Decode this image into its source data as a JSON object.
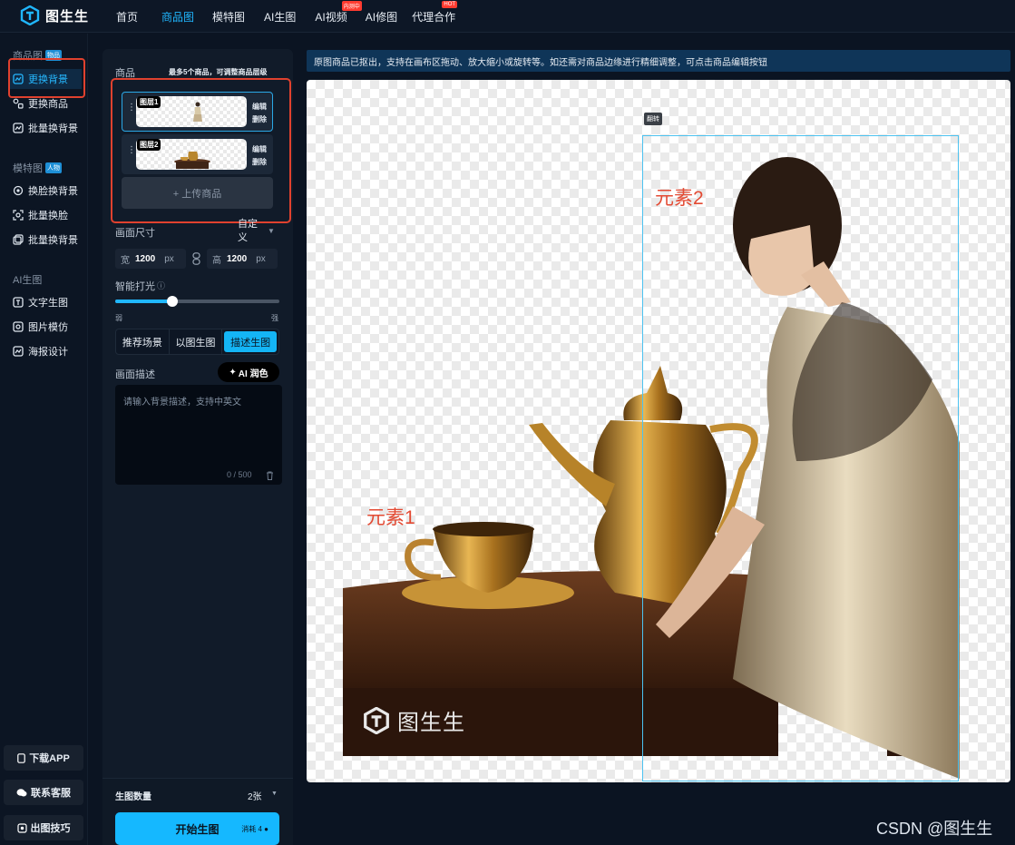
{
  "app": {
    "name": "图生生"
  },
  "nav": [
    {
      "label": "首页"
    },
    {
      "label": "商品图",
      "active": true
    },
    {
      "label": "模特图"
    },
    {
      "label": "AI生图"
    },
    {
      "label": "AI视频",
      "badge": "内测中"
    },
    {
      "label": "AI修图"
    },
    {
      "label": "代理合作",
      "badge": "HOT"
    }
  ],
  "sidebar": {
    "sections": [
      {
        "title": "商品图",
        "tag": "物品",
        "items": [
          {
            "label": "更换背景",
            "active": true
          },
          {
            "label": "更换商品"
          },
          {
            "label": "批量换背景"
          }
        ]
      },
      {
        "title": "模特图",
        "tag": "人物",
        "items": [
          {
            "label": "换脸换背景"
          },
          {
            "label": "批量换脸"
          },
          {
            "label": "批量换背景"
          }
        ]
      },
      {
        "title": "AI生图",
        "items": [
          {
            "label": "文字生图"
          },
          {
            "label": "图片模仿"
          },
          {
            "label": "海报设计"
          }
        ]
      }
    ],
    "bottom": [
      {
        "label": "下载APP"
      },
      {
        "label": "联系客服"
      },
      {
        "label": "出图技巧"
      }
    ]
  },
  "panel": {
    "products_label": "商品",
    "products_hint": "最多5个商品，可调整商品层级",
    "layers": [
      {
        "name": "图层1",
        "edit": "编辑",
        "delete": "删除"
      },
      {
        "name": "图层2",
        "edit": "编辑",
        "delete": "删除"
      }
    ],
    "upload_label": "+ 上传商品",
    "canvas_size_label": "画面尺寸",
    "canvas_size_value": "自定义",
    "width_label": "宽",
    "width_value": "1200",
    "width_unit": "px",
    "height_label": "高",
    "height_value": "1200",
    "height_unit": "px",
    "lighting_label": "智能打光",
    "lighting_min": "弱",
    "lighting_max": "强",
    "lighting_level": 0.35,
    "mode_tabs": [
      {
        "label": "推荐场景"
      },
      {
        "label": "以图生图"
      },
      {
        "label": "描述生图",
        "active": true
      }
    ],
    "desc_label": "画面描述",
    "ai_polish_label": "AI 润色",
    "desc_placeholder": "请输入背景描述，支持中英文",
    "desc_value": "",
    "desc_counter": "0 / 500",
    "count_label": "生图数量",
    "count_value": "2张",
    "generate_label": "开始生图",
    "generate_cost": "消耗 4"
  },
  "banner": "原图商品已抠出，支持在画布区拖动、放大缩小或旋转等。如还需对商品边缘进行精细调整，可点击商品编辑按钮",
  "canvas": {
    "element1_label": "元素1",
    "element2_label": "元素2",
    "flip_label": "翻转",
    "watermark": "图生生"
  },
  "footer_watermark": "CSDN @图生生",
  "colors": {
    "accent": "#20b7ff",
    "highlight": "#e0412e",
    "label_red": "#e34a33"
  }
}
